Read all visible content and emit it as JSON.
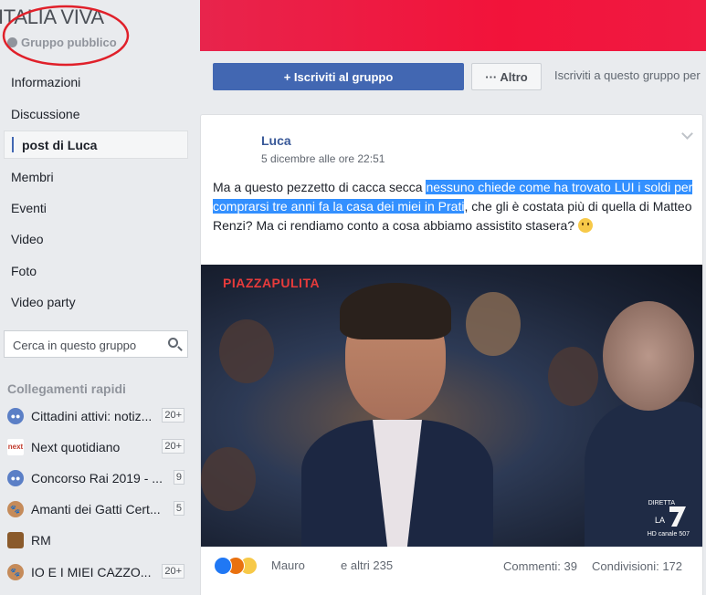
{
  "group": {
    "title": "ITALIA VIVA",
    "type": "Gruppo pubblico"
  },
  "nav": {
    "items": [
      "Informazioni",
      "Discussione",
      "post di Luca",
      "Membri",
      "Eventi",
      "Video",
      "Foto",
      "Video party"
    ],
    "active": "post di Luca"
  },
  "search": {
    "placeholder": "Cerca in questo gruppo"
  },
  "quick_links": {
    "title": "Collegamenti rapidi",
    "items": [
      {
        "label": "Cittadini attivi: notiz...",
        "badge": "20+",
        "icon": "group-icon"
      },
      {
        "label": "Next quotidiano",
        "badge": "20+",
        "icon": "next-logo-icon"
      },
      {
        "label": "Concorso Rai 2019 - ...",
        "badge": "9",
        "icon": "group-icon"
      },
      {
        "label": "Amanti dei Gatti Cert...",
        "badge": "5",
        "icon": "paw-icon"
      },
      {
        "label": "RM",
        "badge": "",
        "icon": "briefcase-icon"
      },
      {
        "label": "IO E I MIEI CAZZO...",
        "badge": "20+",
        "icon": "paw-icon"
      }
    ]
  },
  "header": {
    "join_label": "+ Iscriviti al gruppo",
    "more_label": "··· Altro",
    "subscribed_text": "Iscriviti a questo gruppo per"
  },
  "post": {
    "author": "Luca",
    "date": "5 dicembre alle ore 22:51",
    "text_before": "Ma a questo pezzetto di cacca secca ",
    "text_highlight": "nessuno chiede come ha trovato LUI i soldi per comprarsi tre anni fa la casa dei miei in Prati",
    "text_after": ", che gli è costata più di quella di Matteo Renzi? Ma ci rendiamo conto a cosa abbiamo assistito stasera? ",
    "video": {
      "overlay_title": "PIAZZAPULITA",
      "live_label": "DIRETTA",
      "channel_label": "HD canale 507"
    },
    "reactions": {
      "icons": [
        "like-icon",
        "angry-icon",
        "sad-icon"
      ],
      "reactor": "Mauro",
      "others": "e altri 235"
    },
    "comments": "Commenti: 39",
    "shares": "Condivisioni: 172"
  },
  "colors": {
    "brand": "#4267b2",
    "cover": "#f2133a",
    "highlight": "#3390ff",
    "annotation": "#e0202a"
  }
}
